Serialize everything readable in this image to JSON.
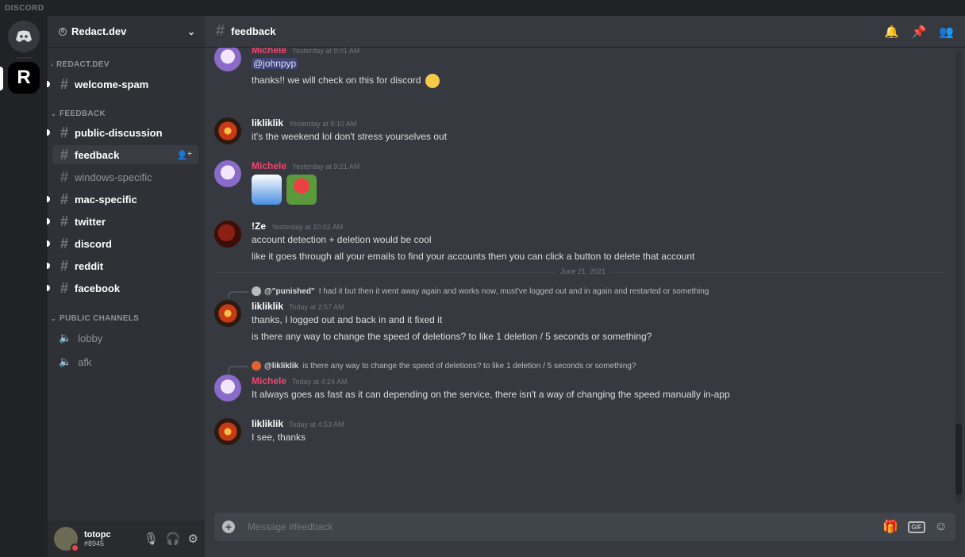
{
  "app": {
    "title": "DISCORD"
  },
  "guilds": {
    "server_initial": "R"
  },
  "server": {
    "name": "Redact.dev"
  },
  "categories": [
    {
      "label": "REDACT.DEV"
    },
    {
      "label": "FEEDBACK"
    },
    {
      "label": "PUBLIC CHANNELS"
    }
  ],
  "channels": {
    "welcome_spam": "welcome-spam",
    "public_discussion": "public-discussion",
    "feedback": "feedback",
    "windows_specific": "windows-specific",
    "mac_specific": "mac-specific",
    "twitter": "twitter",
    "discord": "discord",
    "reddit": "reddit",
    "facebook": "facebook",
    "lobby": "lobby",
    "afk": "afk"
  },
  "user": {
    "name": "totopc",
    "tag": "#8945"
  },
  "header": {
    "channel": "feedback"
  },
  "messages": [
    {
      "author": "Michele",
      "time": "Yesterday at 9:01 AM",
      "mention": "@johnpyp",
      "text": "thanks!! we will check on this for discord"
    },
    {
      "author": "likliklik",
      "time": "Yesterday at 9:10 AM",
      "text": "it's the weekend lol don't stress yourselves out"
    },
    {
      "author": "Michele",
      "time": "Yesterday at 9:21 AM"
    },
    {
      "author": "!Ze",
      "time": "Yesterday at 10:02 AM",
      "text": "account detection + deletion would be cool",
      "text2": "like it goes through all your emails to find your accounts then you can click a button to delete that account"
    },
    {
      "author": "likliklik",
      "time": "Today at 2:57 AM",
      "text": "thanks, I logged out and back in and it fixed it",
      "text2": "is there any way to change the speed of deletions? to like 1 deletion / 5 seconds or something?"
    },
    {
      "author": "Michele",
      "time": "Today at 4:24 AM",
      "text": "It always goes as fast as it can depending on the service, there isn't a way of changing the speed manually in-app"
    },
    {
      "author": "likliklik",
      "time": "Today at 4:53 AM",
      "text": "I see, thanks"
    }
  ],
  "date_divider": "June 21, 2021",
  "replies": [
    {
      "name": "@\"punished\"",
      "text": "I had it but then it went away again and works now, must've logged out and in again and restarted or something"
    },
    {
      "name": "@likliklik",
      "text": "is there any way to change the speed of deletions? to like 1 deletion / 5 seconds or something?"
    }
  ],
  "composer": {
    "placeholder": "Message #feedback"
  },
  "colors": {
    "michele": "#f04770",
    "sidebar": "#2f3136",
    "main": "#36393f",
    "accent": "#5865f2"
  }
}
